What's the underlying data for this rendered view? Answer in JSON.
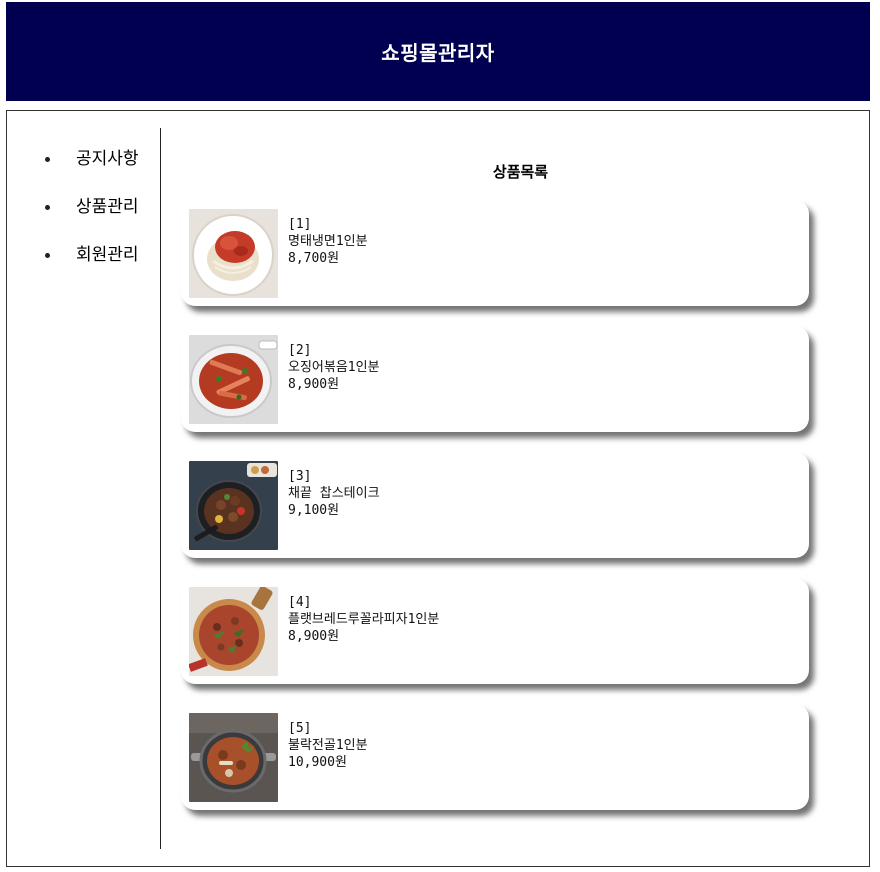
{
  "header": {
    "title": "쇼핑몰관리자"
  },
  "sidebar": {
    "items": [
      {
        "label": "공지사항"
      },
      {
        "label": "상품관리"
      },
      {
        "label": "회원관리"
      }
    ]
  },
  "main": {
    "list_title": "상품목록",
    "products": [
      {
        "index": "[1]",
        "name": "명태냉면1인분",
        "price": "8,700원",
        "image_icon": "naengmyeon-image"
      },
      {
        "index": "[2]",
        "name": "오징어볶음1인분",
        "price": "8,900원",
        "image_icon": "squid-stirfry-image"
      },
      {
        "index": "[3]",
        "name": "채끝 찹스테이크",
        "price": "9,100원",
        "image_icon": "chop-steak-image"
      },
      {
        "index": "[4]",
        "name": "플랫브레드루꼴라피자1인분",
        "price": "8,900원",
        "image_icon": "flatbread-pizza-image"
      },
      {
        "index": "[5]",
        "name": "불락전골1인분",
        "price": "10,900원",
        "image_icon": "hotpot-image"
      }
    ]
  },
  "colors": {
    "header_bg": "#010050",
    "header_text": "#ffffff"
  }
}
